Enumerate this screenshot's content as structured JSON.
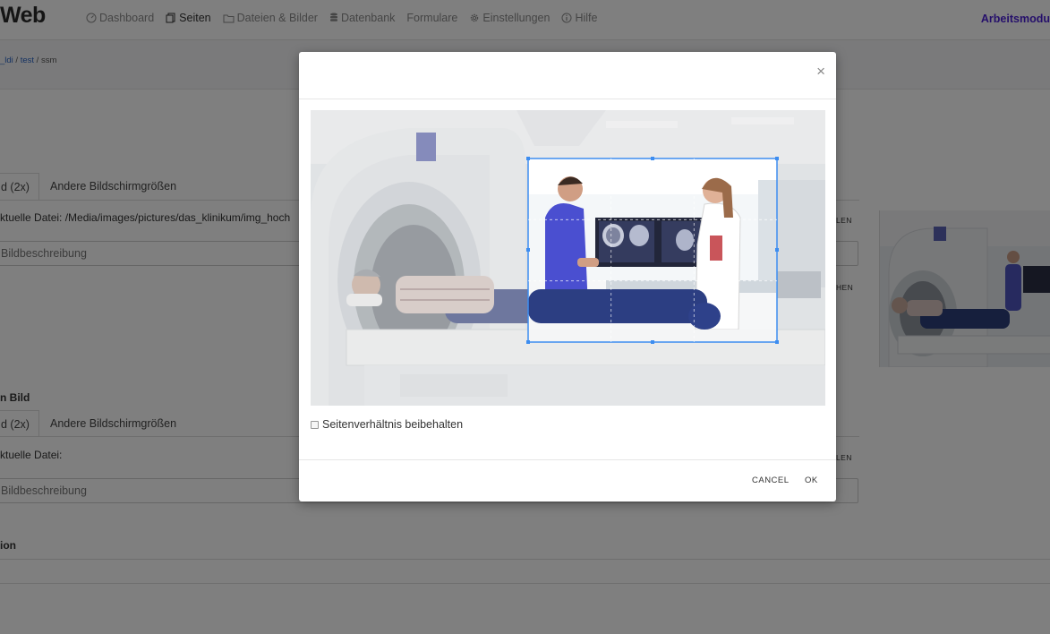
{
  "brand": "Web",
  "nav": {
    "items": [
      {
        "label": "Dashboard",
        "icon": "dashboard-icon"
      },
      {
        "label": "Seiten",
        "icon": "pages-icon",
        "active": true
      },
      {
        "label": "Dateien & Bilder",
        "icon": "folder-icon"
      },
      {
        "label": "Datenbank",
        "icon": "database-icon"
      },
      {
        "label": "Formulare",
        "icon": ""
      },
      {
        "label": "Einstellungen",
        "icon": "gear-icon"
      },
      {
        "label": "Hilfe",
        "icon": "info-icon"
      }
    ],
    "work_mode": "Arbeitsmodu"
  },
  "breadcrumb": {
    "part1": "_ldi",
    "sep1": " / ",
    "part2": "test",
    "sep2": " / ",
    "current": "ssm"
  },
  "background": {
    "section1": {
      "tab_active": "d (2x)",
      "tab_other": "Andere Bildschirmgrößen",
      "current_file": "ktuelle Datei: /Media/images/pictures/das_klinikum/img_hoch",
      "description_placeholder": "Bildbeschreibung",
      "right_label_1": "LEN",
      "right_label_2": "HEN"
    },
    "section2": {
      "heading": "n Bild",
      "tab_active": "d (2x)",
      "tab_other": "Andere Bildschirmgrößen",
      "current_file": "ktuelle Datei:",
      "description_placeholder": "Bildbeschreibung",
      "right_label_1": "LEN"
    },
    "section3": {
      "heading": "ion"
    }
  },
  "modal": {
    "close": "×",
    "keep_ratio_label": "Seitenverhältnis beibehalten",
    "cancel": "CANCEL",
    "ok": "OK"
  },
  "colors": {
    "accent": "#3d8df0",
    "brand_purple": "#4a1fd6",
    "link": "#2a64c4"
  }
}
